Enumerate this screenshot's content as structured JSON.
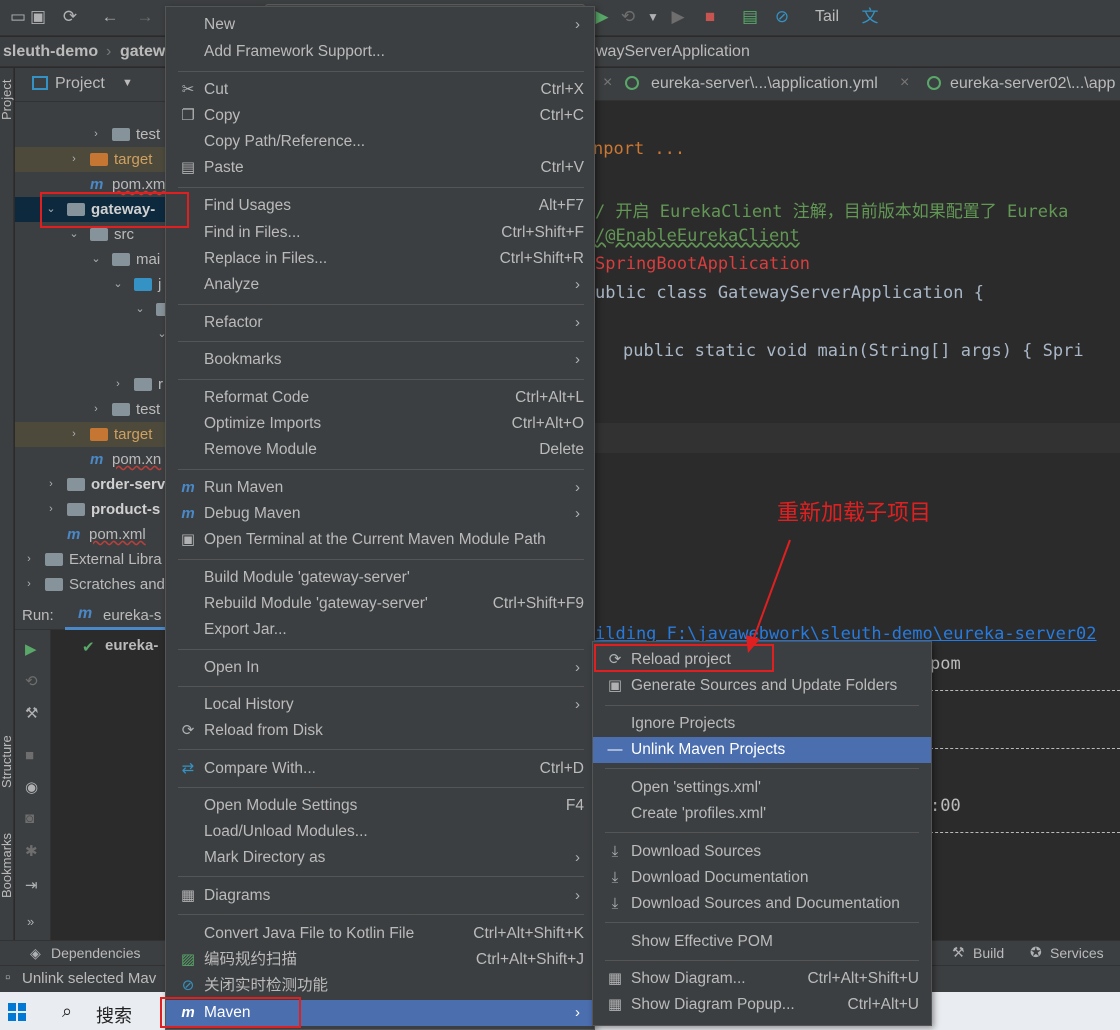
{
  "toolbar": {
    "tail_label": "Tail"
  },
  "navbar": {
    "project": "sleuth-demo",
    "module": "gatew",
    "class_crumb": "wayServerApplication"
  },
  "project_panel": {
    "title": "Project",
    "tree": [
      {
        "label": "test",
        "kind": "folder"
      },
      {
        "label": "target",
        "kind": "folder-orange"
      },
      {
        "label": "pom.xm",
        "kind": "maven"
      },
      {
        "label": "gateway-",
        "kind": "module"
      },
      {
        "label": "src",
        "kind": "folder"
      },
      {
        "label": "mai",
        "kind": "folder"
      },
      {
        "label": "j",
        "kind": "folder-blue"
      },
      {
        "label": "",
        "kind": "pkg"
      },
      {
        "label": "",
        "kind": "pkg"
      },
      {
        "label": "",
        "kind": "empty"
      },
      {
        "label": "r",
        "kind": "folder"
      },
      {
        "label": "test",
        "kind": "folder"
      },
      {
        "label": "target",
        "kind": "folder-orange"
      },
      {
        "label": "pom.xn",
        "kind": "maven"
      },
      {
        "label": "order-serv",
        "kind": "module"
      },
      {
        "label": "product-s",
        "kind": "module"
      },
      {
        "label": "pom.xml",
        "kind": "maven"
      },
      {
        "label": "External Libra",
        "kind": "lib"
      },
      {
        "label": "Scratches and",
        "kind": "scratch"
      }
    ]
  },
  "editor": {
    "tabs": [
      {
        "label": "eureka-server\\...\\application.yml"
      },
      {
        "label": "eureka-server02\\...\\app"
      }
    ],
    "code_lines": [
      {
        "text": "nport ...",
        "kind": "import"
      },
      {
        "text": "/ 开启 EurekaClient 注解，目前版本如果配置了 Eureka",
        "kind": "comment"
      },
      {
        "text": "/@EnableEurekaClient",
        "kind": "comment"
      },
      {
        "text": "SpringBootApplication",
        "kind": "annotation"
      },
      {
        "text": "ublic class GatewayServerApplication {",
        "kind": "code"
      },
      {
        "text": "public static void main(String[] args) { Spri",
        "kind": "code"
      }
    ]
  },
  "run_panel": {
    "label": "Run:",
    "tab": "eureka-s",
    "tree_item": "eureka-",
    "console_lines": [
      {
        "text": "ilding F:\\javawebwork\\sleuth-demo\\eureka-server02"
      },
      {
        "text": "pom"
      },
      {
        "text": ":00"
      }
    ]
  },
  "side_labels": {
    "project": "Project",
    "structure": "Structure",
    "bookmarks": "Bookmarks"
  },
  "bottom_strip": {
    "dependencies": "Dependencies",
    "build": "Build",
    "services": "Services"
  },
  "status_bar": {
    "text": "Unlink selected Mav"
  },
  "taskbar": {
    "search": "搜索"
  },
  "context_menu": {
    "items": [
      {
        "label": "New",
        "shortcut": "",
        "submenu": true,
        "icon": ""
      },
      {
        "label": "Add Framework Support...",
        "shortcut": "",
        "submenu": false,
        "icon": ""
      },
      {
        "label": "Cut",
        "shortcut": "Ctrl+X",
        "submenu": false,
        "icon": "scissors-icon"
      },
      {
        "label": "Copy",
        "shortcut": "Ctrl+C",
        "submenu": false,
        "icon": "copy-icon"
      },
      {
        "label": "Copy Path/Reference...",
        "shortcut": "",
        "submenu": false,
        "icon": ""
      },
      {
        "label": "Paste",
        "shortcut": "Ctrl+V",
        "submenu": false,
        "icon": "paste-icon"
      },
      {
        "label": "Find Usages",
        "shortcut": "Alt+F7",
        "submenu": false,
        "icon": ""
      },
      {
        "label": "Find in Files...",
        "shortcut": "Ctrl+Shift+F",
        "submenu": false,
        "icon": ""
      },
      {
        "label": "Replace in Files...",
        "shortcut": "Ctrl+Shift+R",
        "submenu": false,
        "icon": ""
      },
      {
        "label": "Analyze",
        "shortcut": "",
        "submenu": true,
        "icon": ""
      },
      {
        "label": "Refactor",
        "shortcut": "",
        "submenu": true,
        "icon": ""
      },
      {
        "label": "Bookmarks",
        "shortcut": "",
        "submenu": true,
        "icon": ""
      },
      {
        "label": "Reformat Code",
        "shortcut": "Ctrl+Alt+L",
        "submenu": false,
        "icon": ""
      },
      {
        "label": "Optimize Imports",
        "shortcut": "Ctrl+Alt+O",
        "submenu": false,
        "icon": ""
      },
      {
        "label": "Remove Module",
        "shortcut": "Delete",
        "submenu": false,
        "icon": ""
      },
      {
        "label": "Run Maven",
        "shortcut": "",
        "submenu": true,
        "icon": "maven-run-icon"
      },
      {
        "label": "Debug Maven",
        "shortcut": "",
        "submenu": true,
        "icon": "maven-debug-icon"
      },
      {
        "label": "Open Terminal at the Current Maven Module Path",
        "shortcut": "",
        "submenu": false,
        "icon": "terminal-icon"
      },
      {
        "label": "Build Module 'gateway-server'",
        "shortcut": "",
        "submenu": false,
        "icon": ""
      },
      {
        "label": "Rebuild Module 'gateway-server'",
        "shortcut": "Ctrl+Shift+F9",
        "submenu": false,
        "icon": ""
      },
      {
        "label": "Export Jar...",
        "shortcut": "",
        "submenu": false,
        "icon": ""
      },
      {
        "label": "Open In",
        "shortcut": "",
        "submenu": true,
        "icon": ""
      },
      {
        "label": "Local History",
        "shortcut": "",
        "submenu": true,
        "icon": ""
      },
      {
        "label": "Reload from Disk",
        "shortcut": "",
        "submenu": false,
        "icon": "reload-icon"
      },
      {
        "label": "Compare With...",
        "shortcut": "Ctrl+D",
        "submenu": false,
        "icon": "compare-icon"
      },
      {
        "label": "Open Module Settings",
        "shortcut": "F4",
        "submenu": false,
        "icon": ""
      },
      {
        "label": "Load/Unload Modules...",
        "shortcut": "",
        "submenu": false,
        "icon": ""
      },
      {
        "label": "Mark Directory as",
        "shortcut": "",
        "submenu": true,
        "icon": ""
      },
      {
        "label": "Diagrams",
        "shortcut": "",
        "submenu": true,
        "icon": "diagram-icon"
      },
      {
        "label": "Convert Java File to Kotlin File",
        "shortcut": "Ctrl+Alt+Shift+K",
        "submenu": false,
        "icon": ""
      },
      {
        "label": "编码规约扫描",
        "shortcut": "Ctrl+Alt+Shift+J",
        "submenu": false,
        "icon": "scan-icon"
      },
      {
        "label": "关闭实时检测功能",
        "shortcut": "",
        "submenu": false,
        "icon": "disable-icon"
      },
      {
        "label": "Maven",
        "shortcut": "",
        "submenu": true,
        "icon": "maven-icon"
      }
    ]
  },
  "maven_submenu": {
    "items": [
      {
        "label": "Reload project",
        "shortcut": "",
        "icon": "reload-icon"
      },
      {
        "label": "Generate Sources and Update Folders",
        "shortcut": "",
        "icon": "generate-icon"
      },
      {
        "label": "Ignore Projects",
        "shortcut": "",
        "icon": ""
      },
      {
        "label": "Unlink Maven Projects",
        "shortcut": "",
        "icon": "minus-icon"
      },
      {
        "label": "Open 'settings.xml'",
        "shortcut": "",
        "icon": ""
      },
      {
        "label": "Create 'profiles.xml'",
        "shortcut": "",
        "icon": ""
      },
      {
        "label": "Download Sources",
        "shortcut": "",
        "icon": "download-icon"
      },
      {
        "label": "Download Documentation",
        "shortcut": "",
        "icon": "download-icon"
      },
      {
        "label": "Download Sources and Documentation",
        "shortcut": "",
        "icon": "download-icon"
      },
      {
        "label": "Show Effective POM",
        "shortcut": "",
        "icon": ""
      },
      {
        "label": "Show Diagram...",
        "shortcut": "Ctrl+Alt+Shift+U",
        "icon": "diagram-icon"
      },
      {
        "label": "Show Diagram Popup...",
        "shortcut": "Ctrl+Alt+U",
        "icon": "diagram-icon"
      }
    ]
  },
  "annotation": {
    "text": "重新加载子项目"
  },
  "colors": {
    "selection": "#4b6eaf",
    "annotation_red": "#e02020",
    "menu_bg": "#3c3f41",
    "editor_bg": "#2b2b2b"
  }
}
